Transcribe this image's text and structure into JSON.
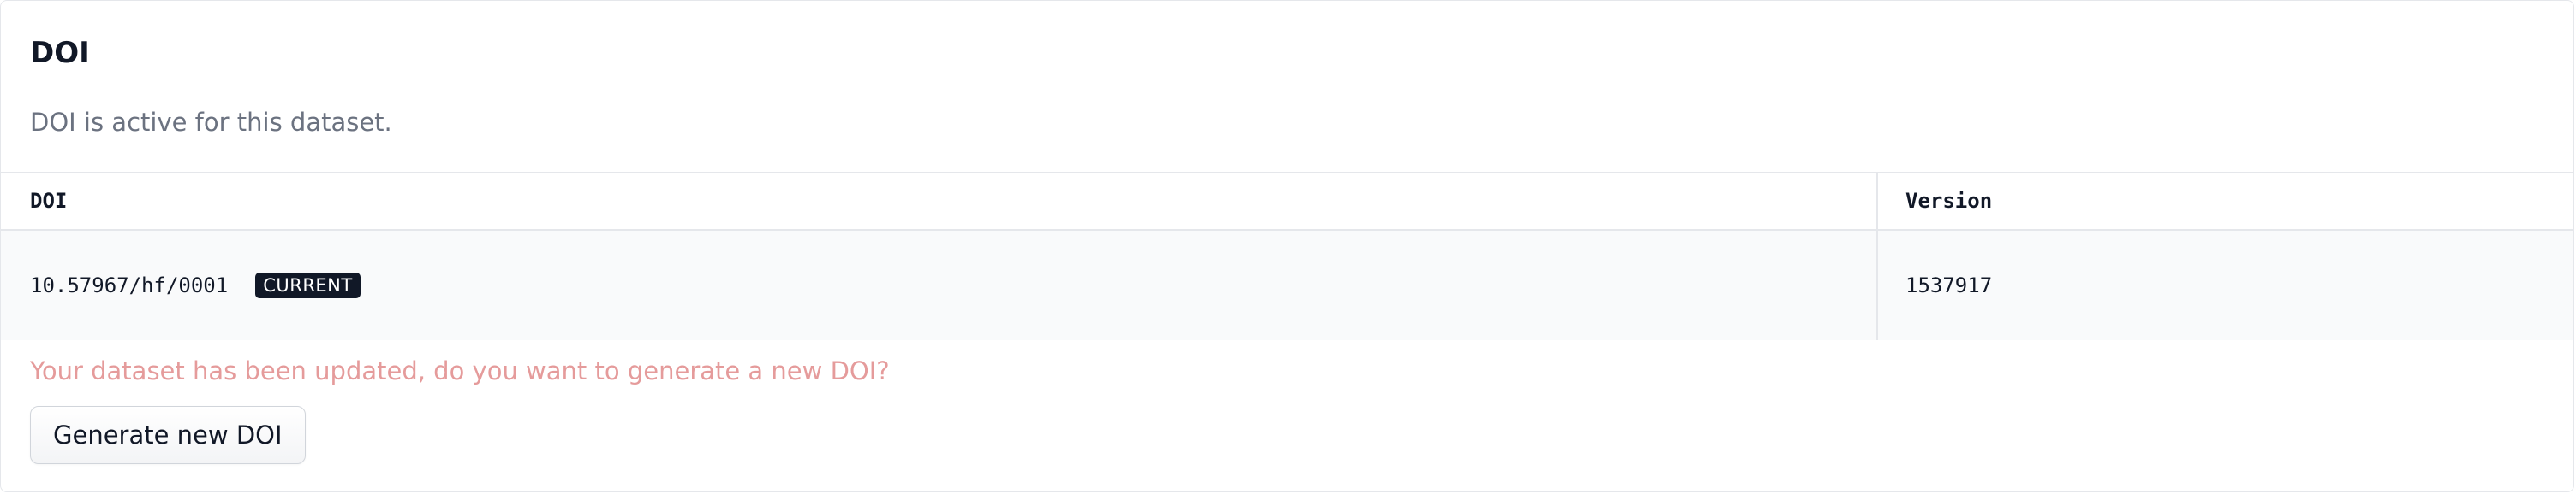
{
  "section": {
    "title": "DOI",
    "subtitle": "DOI is active for this dataset."
  },
  "table": {
    "headers": [
      "DOI",
      "Version"
    ],
    "rows": [
      {
        "doi": "10.57967/hf/0001",
        "badge": "CURRENT",
        "version": "1537917"
      }
    ]
  },
  "notice": {
    "message": "Your dataset has been updated, do you want to generate a new DOI?",
    "button_label": "Generate new DOI"
  },
  "colors": {
    "badge_bg": "#111827",
    "warning_text": "#e59b9b",
    "row_bg": "#f9fafb"
  }
}
